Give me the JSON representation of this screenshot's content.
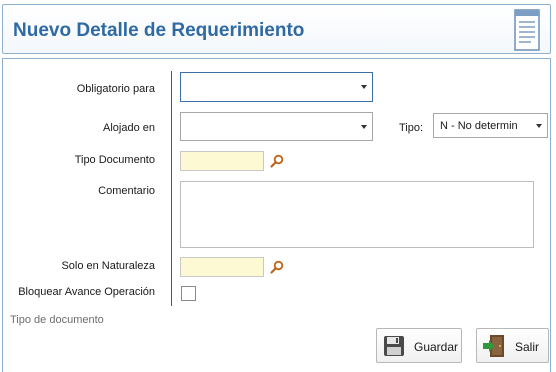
{
  "header": {
    "title": "Nuevo Detalle de Requerimiento",
    "icon": "document-icon"
  },
  "form": {
    "obligatorio_label": "Obligatorio para",
    "obligatorio_value": "",
    "alojado_label": "Alojado en",
    "alojado_value": "",
    "tipo_label": "Tipo:",
    "tipo_value": "N - No determin",
    "tipo_documento_label": "Tipo Documento",
    "tipo_documento_value": "",
    "comentario_label": "Comentario",
    "comentario_value": "",
    "solo_naturaleza_label": "Solo en Naturaleza",
    "solo_naturaleza_value": "",
    "bloquear_label": "Bloquear Avance Operación",
    "bloquear_checked": false
  },
  "status_hint": "Tipo de documento",
  "buttons": {
    "guardar": "Guardar",
    "salir": "Salir"
  },
  "colors": {
    "title": "#2f6aa4",
    "lookup_bg": "#fdf9d2"
  }
}
